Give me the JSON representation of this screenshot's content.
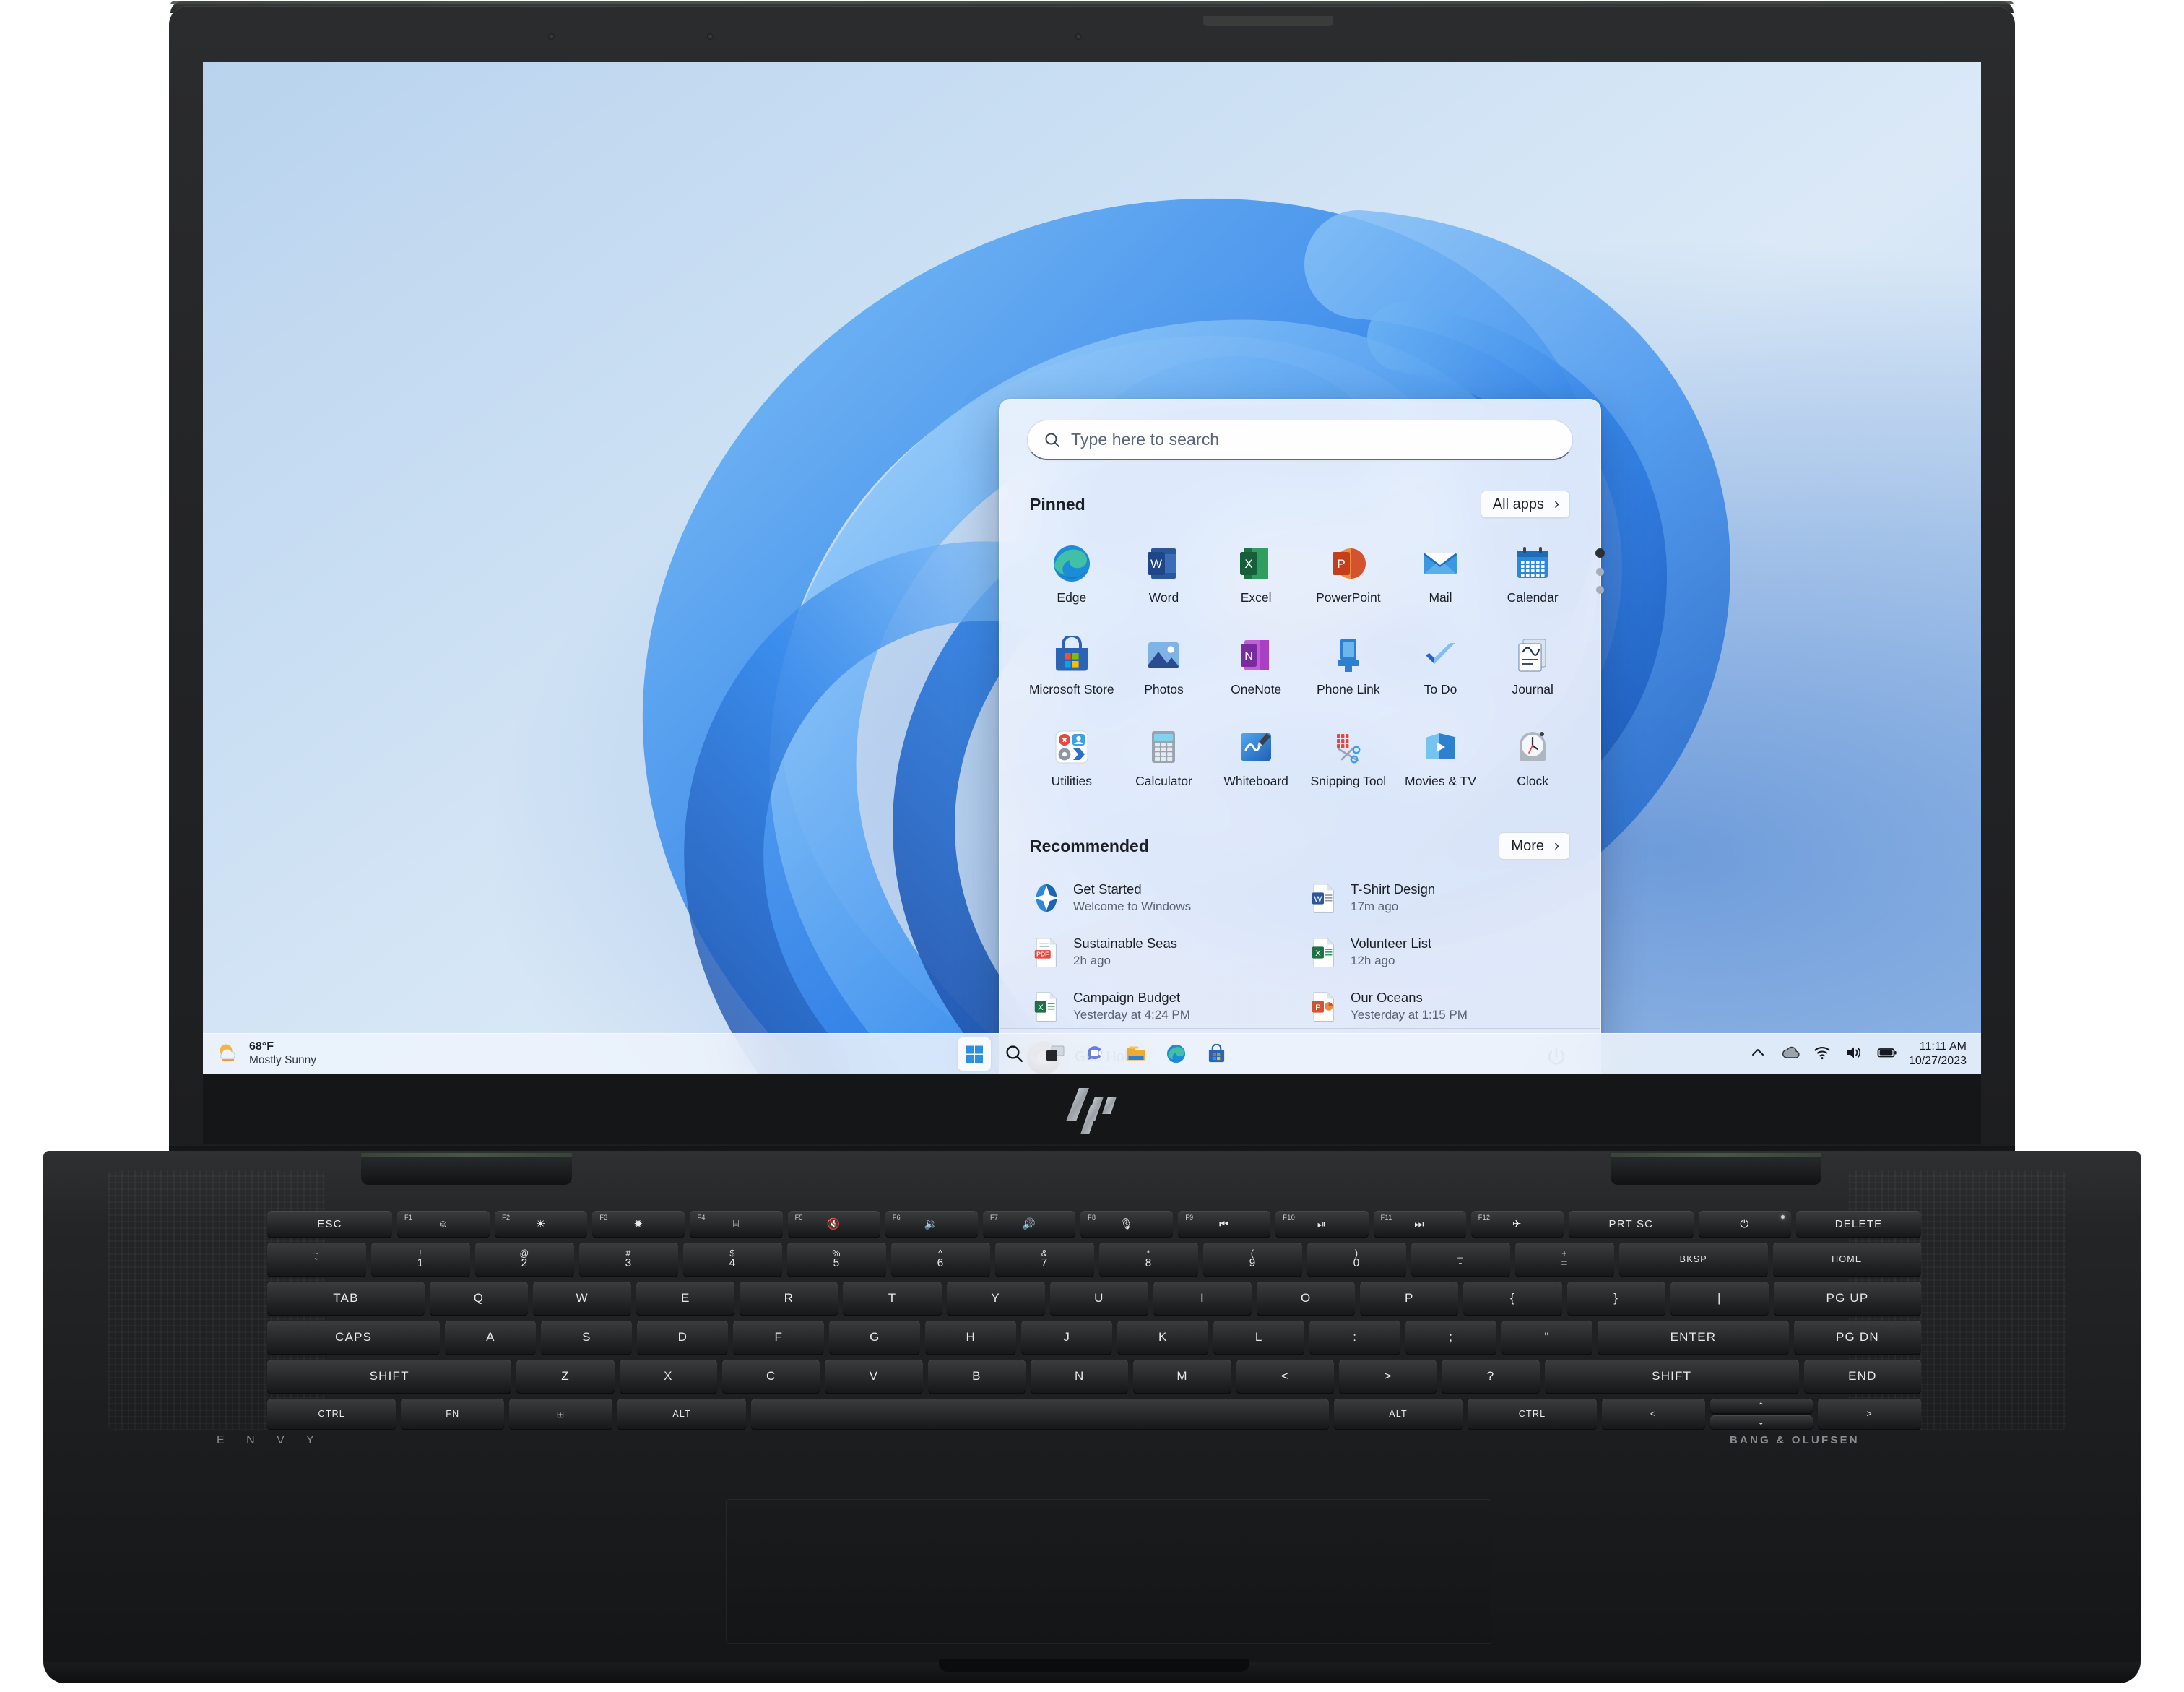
{
  "device": {
    "brand_logo": "hp-logo",
    "left_branding": "E N V Y",
    "right_branding": "BANG & OLUFSEN"
  },
  "search": {
    "placeholder": "Type here to search",
    "icon": "search-icon"
  },
  "pinned": {
    "title": "Pinned",
    "all_apps_label": "All apps",
    "all_apps_chevron": "›",
    "pages": 3,
    "active_page": 1,
    "apps": [
      {
        "label": "Edge",
        "icon": "edge-icon"
      },
      {
        "label": "Word",
        "icon": "word-icon"
      },
      {
        "label": "Excel",
        "icon": "excel-icon"
      },
      {
        "label": "PowerPoint",
        "icon": "powerpoint-icon"
      },
      {
        "label": "Mail",
        "icon": "mail-icon"
      },
      {
        "label": "Calendar",
        "icon": "calendar-icon"
      },
      {
        "label": "Microsoft Store",
        "icon": "microsoft-store-icon"
      },
      {
        "label": "Photos",
        "icon": "photos-icon"
      },
      {
        "label": "OneNote",
        "icon": "onenote-icon"
      },
      {
        "label": "Phone Link",
        "icon": "phone-link-icon"
      },
      {
        "label": "To Do",
        "icon": "to-do-icon"
      },
      {
        "label": "Journal",
        "icon": "journal-icon"
      },
      {
        "label": "Utilities",
        "icon": "utilities-folder-icon"
      },
      {
        "label": "Calculator",
        "icon": "calculator-icon"
      },
      {
        "label": "Whiteboard",
        "icon": "whiteboard-icon"
      },
      {
        "label": "Snipping Tool",
        "icon": "snipping-tool-icon"
      },
      {
        "label": "Movies & TV",
        "icon": "movies-tv-icon"
      },
      {
        "label": "Clock",
        "icon": "clock-icon"
      }
    ]
  },
  "recommended": {
    "title": "Recommended",
    "more_label": "More",
    "more_chevron": "›",
    "items": [
      {
        "name": "Get Started",
        "sub": "Welcome to Windows",
        "icon": "get-started-icon"
      },
      {
        "name": "T-Shirt Design",
        "sub": "17m ago",
        "icon": "word-doc-icon"
      },
      {
        "name": "Sustainable Seas",
        "sub": "2h ago",
        "icon": "pdf-doc-icon"
      },
      {
        "name": "Volunteer List",
        "sub": "12h ago",
        "icon": "excel-doc-icon"
      },
      {
        "name": "Campaign Budget",
        "sub": "Yesterday at 4:24 PM",
        "icon": "excel-doc-icon"
      },
      {
        "name": "Our Oceans",
        "sub": "Yesterday at 1:15 PM",
        "icon": "powerpoint-doc-icon"
      }
    ]
  },
  "account": {
    "user_name": "Guri Holter",
    "avatar": "user-avatar",
    "power_icon": "power-icon"
  },
  "taskbar": {
    "weather": {
      "temperature": "68°F",
      "condition": "Mostly Sunny",
      "icon": "sun-cloud-icon"
    },
    "items": [
      {
        "name": "start-button",
        "icon": "windows-logo-icon",
        "active": true
      },
      {
        "name": "search-button",
        "icon": "search-icon",
        "active": false
      },
      {
        "name": "task-view-button",
        "icon": "task-view-icon",
        "active": false
      },
      {
        "name": "chat-button",
        "icon": "chat-icon",
        "active": false
      },
      {
        "name": "file-explorer-button",
        "icon": "folder-icon",
        "active": false
      },
      {
        "name": "edge-button",
        "icon": "edge-icon",
        "active": false
      },
      {
        "name": "microsoft-store-button",
        "icon": "microsoft-store-icon",
        "active": false
      }
    ],
    "tray": [
      {
        "name": "show-hidden-icons",
        "icon": "chevron-up-icon"
      },
      {
        "name": "onedrive",
        "icon": "cloud-icon"
      },
      {
        "name": "network",
        "icon": "wifi-icon"
      },
      {
        "name": "volume",
        "icon": "speaker-icon"
      },
      {
        "name": "battery",
        "icon": "battery-icon"
      }
    ],
    "clock": {
      "time": "11:11 AM",
      "date": "10/27/2023"
    }
  },
  "keyboard": {
    "fn_row": [
      {
        "label": "ESC",
        "fn": ""
      },
      {
        "label": "☺",
        "fn": "F1"
      },
      {
        "label": "☀",
        "fn": "F2"
      },
      {
        "label": "✹",
        "fn": "F3"
      },
      {
        "label": "⌸",
        "fn": "F4"
      },
      {
        "label": "🔇",
        "fn": "F5"
      },
      {
        "label": "🔉",
        "fn": "F6"
      },
      {
        "label": "🔊",
        "fn": "F7"
      },
      {
        "label": "🎙",
        "fn": "F8"
      },
      {
        "label": "⏮",
        "fn": "F9"
      },
      {
        "label": "⏯",
        "fn": "F10"
      },
      {
        "label": "⏭",
        "fn": "F11"
      },
      {
        "label": "✈",
        "fn": "F12"
      },
      {
        "label": "PRT SC",
        "fn": ""
      },
      {
        "label": "⏻",
        "fn": ""
      },
      {
        "label": "DELETE",
        "fn": ""
      }
    ],
    "num_row": [
      {
        "top": "~",
        "bot": "`"
      },
      {
        "top": "!",
        "bot": "1"
      },
      {
        "top": "@",
        "bot": "2"
      },
      {
        "top": "#",
        "bot": "3"
      },
      {
        "top": "$",
        "bot": "4"
      },
      {
        "top": "%",
        "bot": "5"
      },
      {
        "top": "^",
        "bot": "6"
      },
      {
        "top": "&",
        "bot": "7"
      },
      {
        "top": "*",
        "bot": "8"
      },
      {
        "top": "(",
        "bot": "9"
      },
      {
        "top": ")",
        "bot": "0"
      },
      {
        "top": "_",
        "bot": "-"
      },
      {
        "top": "+",
        "bot": "="
      },
      {
        "top": "",
        "bot": "BKSP"
      },
      {
        "top": "",
        "bot": "HOME"
      }
    ],
    "row_q": [
      "TAB",
      "Q",
      "W",
      "E",
      "R",
      "T",
      "Y",
      "U",
      "I",
      "O",
      "P",
      "{",
      "}",
      "|",
      "PG UP"
    ],
    "row_a": [
      "CAPS",
      "A",
      "S",
      "D",
      "F",
      "G",
      "H",
      "J",
      "K",
      "L",
      ":",
      ";",
      "\"",
      "ENTER",
      "PG DN"
    ],
    "row_z": [
      "SHIFT",
      "Z",
      "X",
      "C",
      "V",
      "B",
      "N",
      "M",
      "<",
      ">",
      "?",
      "SHIFT",
      "END"
    ],
    "row_ctrl": [
      "CTRL",
      "FN",
      "⊞",
      "ALT",
      "",
      "ALT",
      "CTRL",
      "<",
      ">"
    ],
    "arrows": {
      "up": "⌃",
      "down": "⌄"
    }
  }
}
